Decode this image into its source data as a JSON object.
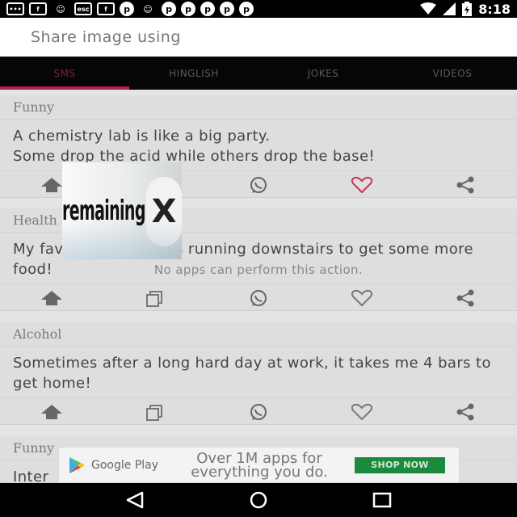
{
  "status_bar": {
    "time": "8:18",
    "icons": [
      "message-icon",
      "facebook-icon",
      "app-icon",
      "esc-icon",
      "facebook-icon",
      "pinterest-icon",
      "app-icon",
      "pinterest-icon",
      "pinterest-icon",
      "pinterest-icon",
      "pinterest-icon",
      "pinterest-icon"
    ],
    "esc_label": "esc"
  },
  "share_header": {
    "title": "Share image using"
  },
  "tabs": [
    {
      "label": "SMS",
      "active": true
    },
    {
      "label": "HINGLISH",
      "active": false
    },
    {
      "label": "JOKES",
      "active": false
    },
    {
      "label": "VIDEOS",
      "active": false
    }
  ],
  "cards": [
    {
      "category": "Funny",
      "text": "A chemistry lab is like a big party.\nSome drop the acid while others drop the base!",
      "liked": true
    },
    {
      "category": "Health and Exercise",
      "text": "My favorite exercise is running downstairs to get some more food!",
      "liked": false
    },
    {
      "category": "Alcohol",
      "text": "Sometimes after a long hard day at work, it takes me 4 bars to get home!",
      "liked": false
    },
    {
      "category": "Funny",
      "text": "Inter",
      "liked": false
    }
  ],
  "no_apps_message": "No apps can perform this action.",
  "popup": {
    "text": "remaining",
    "close_symbol": "X"
  },
  "ad": {
    "brand": "Google Play",
    "headline": "Over 1M apps for everything you do.",
    "cta": "SHOP NOW"
  },
  "colors": {
    "accent": "#b0204a",
    "like_active": "#c8325a",
    "ad_cta": "#1b8a3f"
  }
}
